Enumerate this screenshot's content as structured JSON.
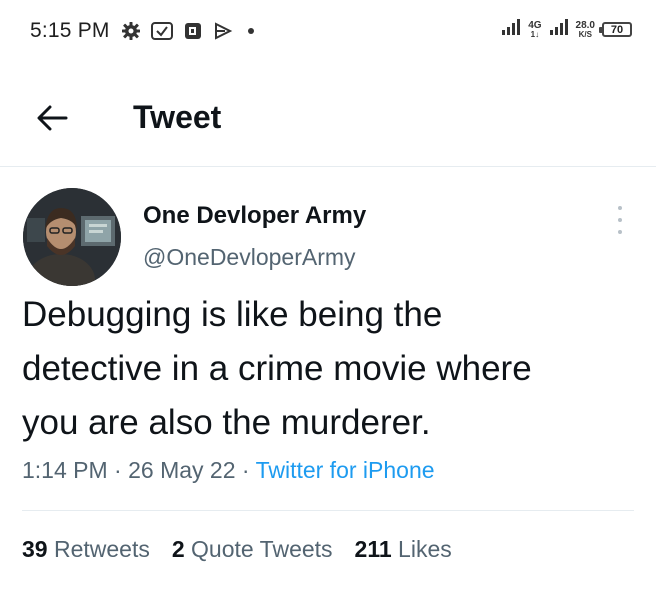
{
  "status_bar": {
    "time": "5:15 PM",
    "network_type": "4G",
    "network_sub": "1↓",
    "speed_value": "28.0",
    "speed_unit": "K/S",
    "battery": "70",
    "icons_left": [
      "gear-icon",
      "checkbox-icon",
      "office-icon",
      "play-icon",
      "dot-icon"
    ],
    "icons_right": [
      "signal-icon",
      "signal-icon"
    ]
  },
  "header": {
    "back_icon": "arrow-left-icon",
    "title": "Tweet"
  },
  "tweet": {
    "author_name": "One Devloper Army",
    "author_handle": "@OneDevloperArmy",
    "more_icon": "more-vertical-icon",
    "text": "Debugging is like being the\ndetective in a crime movie where\nyou are also the murderer.",
    "time": "1:14 PM",
    "date": "26 May 22",
    "separator": "·",
    "source": "Twitter for iPhone",
    "stats": {
      "retweets_count": "39",
      "retweets_label": "Retweets",
      "quotes_count": "2",
      "quotes_label": "Quote Tweets",
      "likes_count": "211",
      "likes_label": "Likes"
    }
  },
  "colors": {
    "text_primary": "#0f1419",
    "text_secondary": "#536471",
    "link": "#1d9bf0",
    "divider": "#e6ecf0"
  }
}
